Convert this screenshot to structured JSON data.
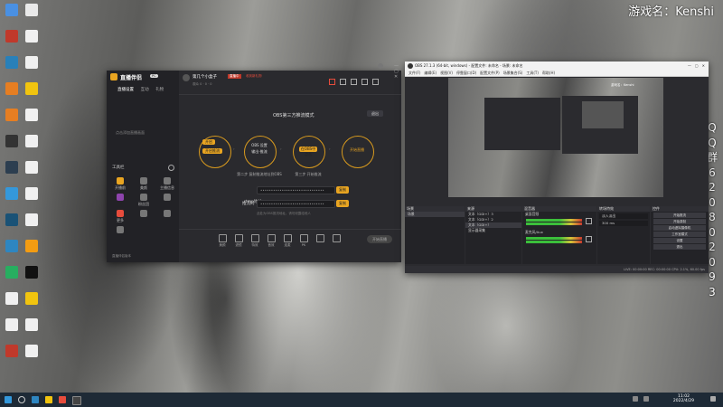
{
  "overlay": {
    "game_name": "游戏名：Kenshi",
    "qq_group_chars": [
      "Q",
      "Q",
      "群",
      "6",
      "2",
      "0",
      "8",
      "0",
      "2",
      "0",
      "9",
      "3"
    ]
  },
  "desktop": {
    "icons": [
      {
        "label": "",
        "color": "#4a90e2"
      },
      {
        "label": "",
        "color": "#e9e9e9"
      },
      {
        "label": "",
        "color": "#c0392b"
      },
      {
        "label": "",
        "color": "#f0f0f0"
      },
      {
        "label": "",
        "color": "#2980b9"
      },
      {
        "label": "",
        "color": "#f0f0f0"
      },
      {
        "label": "",
        "color": "#e67e22"
      },
      {
        "label": "",
        "color": "#f1c40f"
      },
      {
        "label": "",
        "color": "#e67e22"
      },
      {
        "label": "",
        "color": "#f0f0f0"
      },
      {
        "label": "",
        "color": "#333"
      },
      {
        "label": "",
        "color": "#f0f0f0"
      },
      {
        "label": "",
        "color": "#2c3e50"
      },
      {
        "label": "",
        "color": "#f0f0f0"
      },
      {
        "label": "",
        "color": "#3498db"
      },
      {
        "label": "",
        "color": "#f0f0f0"
      },
      {
        "label": "",
        "color": "#1a5276"
      },
      {
        "label": "",
        "color": "#f0f0f0"
      },
      {
        "label": "",
        "color": "#2e86c1"
      },
      {
        "label": "",
        "color": "#f39c12"
      },
      {
        "label": "",
        "color": "#27ae60"
      },
      {
        "label": "",
        "color": "#111"
      },
      {
        "label": "",
        "color": "#f0f0f0"
      },
      {
        "label": "",
        "color": "#f1c40f"
      },
      {
        "label": "",
        "color": "#f0f0f0"
      },
      {
        "label": "",
        "color": "#f0f0f0"
      },
      {
        "label": "",
        "color": "#c0392b"
      },
      {
        "label": "",
        "color": "#f0f0f0"
      }
    ]
  },
  "live_app": {
    "brand": "直播伴侣",
    "brand_badge": "PC",
    "tabs": [
      "直播设置",
      "互动",
      "礼物"
    ],
    "stream_title": "第几个小盒子",
    "status_badge": "直播中",
    "status_badge2": "收到新礼物",
    "stats": [
      "观众",
      "0",
      "0",
      "0"
    ],
    "sidebar_hint": "点击添加直播画面",
    "section_label": "工具栏",
    "tools": [
      "开播前",
      "美颜",
      "主播信息",
      "",
      "粉丝团",
      "",
      "更多",
      "",
      "",
      ""
    ],
    "card_title": "OBS第三方推流模式",
    "card_button": "退出",
    "step1_btn": "开启",
    "step1_btn2": "开启推流",
    "step1_label": "",
    "step2_title": "OBS 设置",
    "step2_sub": "输出-推流",
    "step2_label": "第二步 复制推流地址到OBS",
    "step3_label": "第三步 开始推流",
    "step3_sub": "在OBS中点击",
    "step4_label": "开始直播",
    "step4_sub": "",
    "rtmp_label": "rtmp地址",
    "rtmp_value": "••••••••••••••••••••••••••••••",
    "rtmp_copy": "复制",
    "key_label": "推流码",
    "key_value": "••••••••••••••••••••••••••••••",
    "key_copy": "复制",
    "note": "此处为OBS推流地址，请勿泄露给他人",
    "bottom_tools": [
      "美颜",
      "滤镜",
      "特效",
      "音效",
      "连麦",
      "PK",
      "",
      ""
    ],
    "bottom_button": "开始直播",
    "footer": "直播伴侣版本"
  },
  "obs": {
    "title": "OBS 27.1.3 (64-bit, windows) - 配置文件: 未命名 - 场景: 未命名",
    "menu": [
      "文件(F)",
      "编辑(E)",
      "视图(V)",
      "停靠窗口(D)",
      "配置文件(P)",
      "场景集合(S)",
      "工具(T)",
      "帮助(H)"
    ],
    "docks": {
      "scenes": {
        "title": "场景",
        "items": [
          "场景"
        ]
      },
      "sources": {
        "title": "来源",
        "items": [
          "文本（GDI+）3",
          "文本（GDI+）2",
          "文本（GDI+）",
          "显示器采集"
        ]
      },
      "mixer": {
        "title": "混音器",
        "channels": [
          "桌面音频",
          "麦克风/Aux"
        ]
      },
      "transitions": {
        "title": "转场特效",
        "type": "淡入淡出",
        "duration": "300 ms"
      },
      "controls": {
        "title": "控件",
        "buttons": [
          "开始推流",
          "开始录制",
          "启动虚拟摄像机",
          "工作室模式",
          "设置",
          "退出"
        ]
      }
    },
    "status": "LIVE: 00:00:00  REC: 00:00:00  CPU: 2.1%, 60.00 fps"
  },
  "taskbar": {
    "time": "11:02",
    "date": "2022/4/29"
  }
}
